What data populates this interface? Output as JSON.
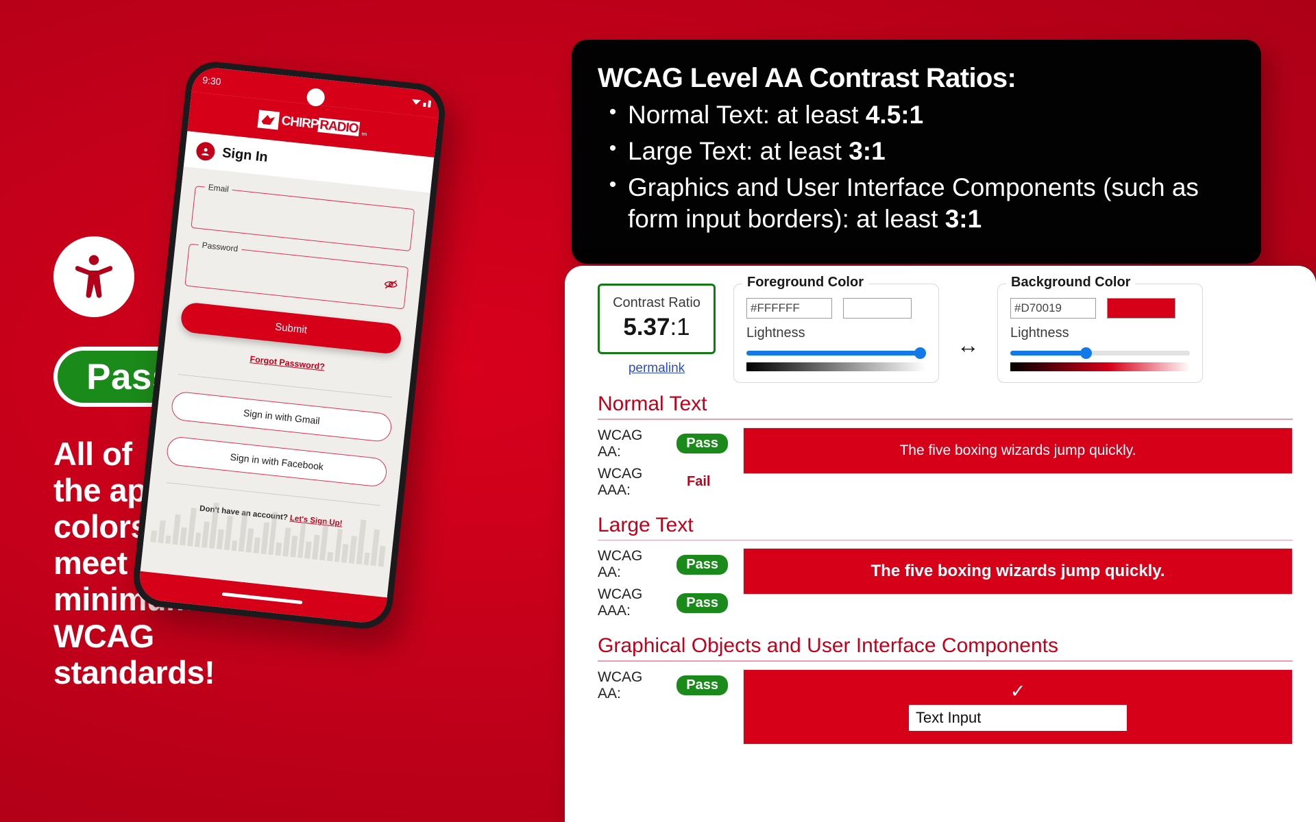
{
  "left": {
    "a11y_icon": "accessibility-person-icon",
    "pass_badge": "Pass",
    "tagline_lines": [
      "All of",
      "the app’s",
      "colors",
      "meet",
      "minimum",
      "WCAG",
      "standards!"
    ],
    "colors": {
      "background_red": "#C4001A",
      "pass_green": "#1A8A1A",
      "white": "#FFFFFF"
    }
  },
  "phone": {
    "status_time": "9:30",
    "app_logo": {
      "brand_first": "CHIRP",
      "brand_second": "RADIO",
      "suffix": "tm",
      "bird_icon": "bird-icon"
    },
    "signin_header": {
      "avatar_icon": "user-circle-icon",
      "title": "Sign In"
    },
    "fields": [
      {
        "label": "Email",
        "value": "",
        "icon": ""
      },
      {
        "label": "Password",
        "value": "",
        "icon": "eye-off-icon"
      }
    ],
    "submit_label": "Submit",
    "forgot_label": "Forgot Password?",
    "social_buttons": [
      "Sign in with Gmail",
      "Sign in with Facebook"
    ],
    "signup_prompt": "Don't have an account?",
    "signup_link": "Let's Sign Up!",
    "eq_heights": [
      18,
      34,
      12,
      46,
      27,
      58,
      22,
      40,
      70,
      30,
      52,
      16,
      62,
      36,
      24,
      48,
      66,
      20,
      44,
      32,
      56,
      26,
      38,
      60,
      14,
      50,
      28,
      42,
      68,
      19,
      55,
      31
    ]
  },
  "black_card": {
    "title": "WCAG Level AA Contrast Ratios:",
    "bullets": [
      {
        "text": "Normal Text: at least ",
        "bold": "4.5:1"
      },
      {
        "text": "Large Text: at least ",
        "bold": "3:1"
      },
      {
        "text": "Graphics and User Interface Components (such as form input borders): at least ",
        "bold": "3:1"
      }
    ],
    "bullet_glyph": "•"
  },
  "checker": {
    "ratio_label": "Contrast Ratio",
    "ratio_value": "5.37",
    "ratio_suffix": ":1",
    "permalink": "permalink",
    "swap_icon": "↔",
    "foreground": {
      "legend": "Foreground Color",
      "hex": "#FFFFFF",
      "swatch": "#FFFFFF",
      "lightness_label": "Lightness",
      "lightness_pct": 100
    },
    "background": {
      "legend": "Background Color",
      "hex": "#D70019",
      "swatch": "#D70019",
      "lightness_label": "Lightness",
      "lightness_pct": 42
    },
    "sections": [
      {
        "heading": "Normal Text",
        "rows": [
          {
            "label": "WCAG AA:",
            "result": "Pass",
            "state": "pass"
          },
          {
            "label": "WCAG AAA:",
            "result": "Fail",
            "state": "fail"
          }
        ],
        "sample_text": "The five boxing wizards jump quickly."
      },
      {
        "heading": "Large Text",
        "rows": [
          {
            "label": "WCAG AA:",
            "result": "Pass",
            "state": "pass"
          },
          {
            "label": "WCAG AAA:",
            "result": "Pass",
            "state": "pass"
          }
        ],
        "sample_text": "The five boxing wizards jump quickly."
      },
      {
        "heading": "Graphical Objects and User Interface Components",
        "rows": [
          {
            "label": "WCAG AA:",
            "result": "Pass",
            "state": "pass"
          }
        ],
        "check_glyph": "✓",
        "input_text": "Text Input"
      }
    ]
  }
}
